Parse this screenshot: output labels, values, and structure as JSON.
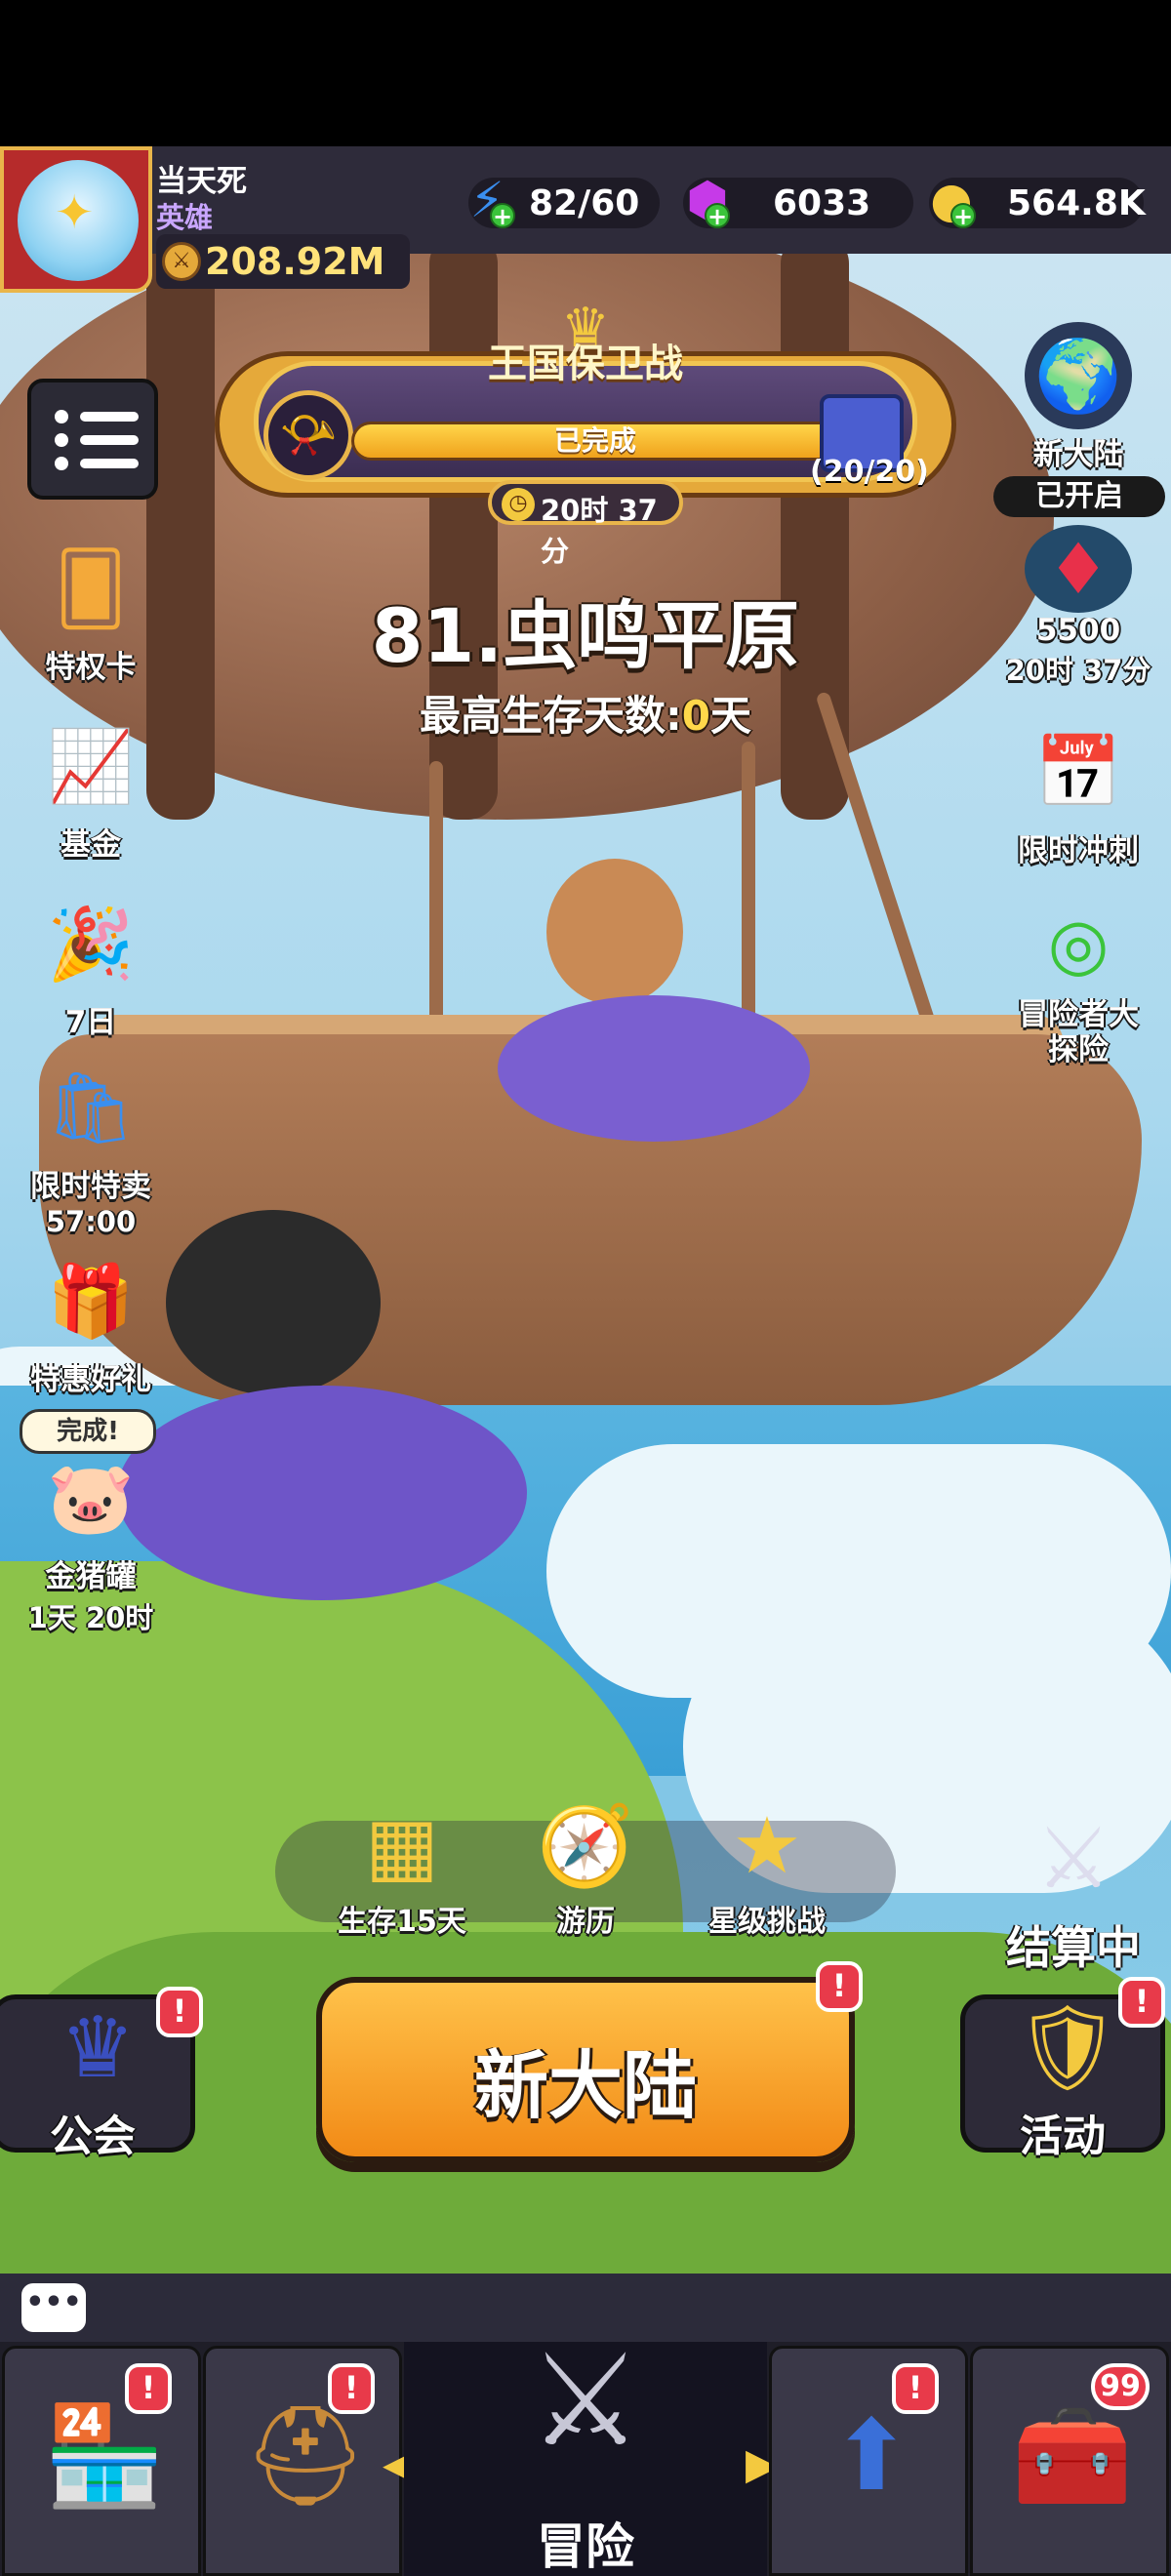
{
  "player": {
    "name": "当天死",
    "title": "英雄",
    "power": "208.92M"
  },
  "resources": {
    "energy": "82/60",
    "gems": "6033",
    "gold": "564.8K"
  },
  "event": {
    "title": "王国保卫战",
    "status": "已完成",
    "progress": "(20/20)",
    "progress_fraction": 1.0,
    "timer": "20时 37分"
  },
  "stage": {
    "name": "81.虫鸣平原",
    "survive_prefix": "最高生存天数:",
    "survive_days": "0",
    "survive_suffix": "天"
  },
  "left_icons": [
    {
      "label": "特权卡",
      "sub": ""
    },
    {
      "label": "基金",
      "sub": ""
    },
    {
      "label": "7日",
      "sub": ""
    },
    {
      "label": "限时特卖",
      "sub": "57:00"
    },
    {
      "label": "特惠好礼",
      "sub": ""
    },
    {
      "label": "金猪罐",
      "sub": "1天 20时",
      "tag": "完成!"
    }
  ],
  "right_icons": {
    "new_continent": {
      "label": "新大陆",
      "badge": "已开启"
    },
    "crystal": {
      "value": "5500",
      "timer": "20时 37分"
    },
    "sprint": {
      "label": "限时冲刺"
    },
    "explore": {
      "label": "冒险者大探险"
    }
  },
  "actions": {
    "survive15": "生存15天",
    "travel": "游历",
    "star_challenge": "星级挑战",
    "settling": "结算中"
  },
  "main_button": "新大陆",
  "guild_button": "公会",
  "activity_button": "活动",
  "alert_mark": "!",
  "nav": {
    "active_label": "冒险",
    "chest_count": "99"
  },
  "colors": {
    "accent_orange": "#f28a16",
    "alert_red": "#e83a4a",
    "gold_text": "#ffe27a"
  }
}
